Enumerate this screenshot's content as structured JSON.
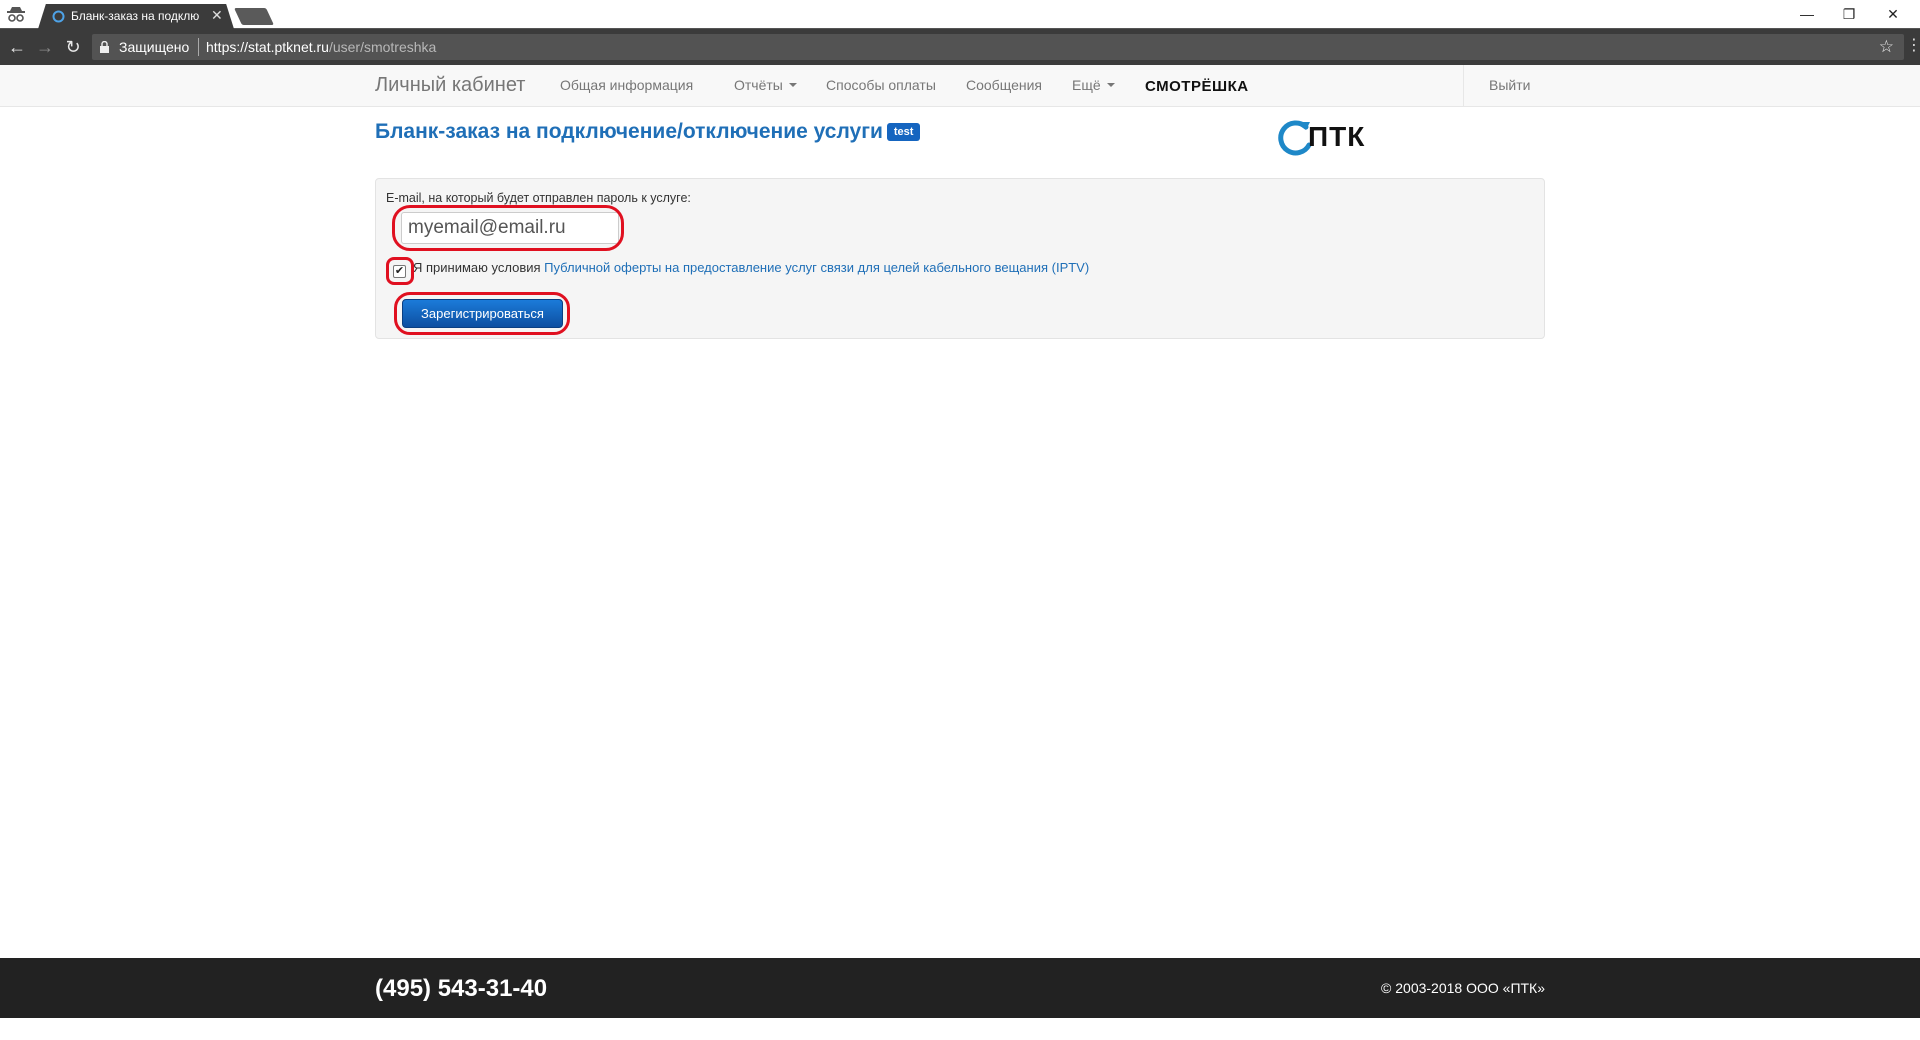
{
  "browser": {
    "tab_title": "Бланк-заказ на подклю",
    "tab_close": "✕",
    "secure_label": "Защищено",
    "url_host": "https://stat.ptknet.ru",
    "url_path": "/user/smotreshka",
    "window_controls": {
      "minimize": "—",
      "restore": "❐",
      "close": "✕"
    },
    "nav": {
      "back": "←",
      "forward": "→",
      "reload": "↻"
    },
    "star": "☆",
    "menu": "⋮"
  },
  "navbar": {
    "brand": "Личный кабинет",
    "items": [
      {
        "label": "Общая информация"
      },
      {
        "label": "Отчёты"
      },
      {
        "label": "Способы оплаты"
      },
      {
        "label": "Сообщения"
      },
      {
        "label": "Ещё"
      }
    ],
    "partner_logo": "СМОТРЁШКА",
    "logout": "Выйти"
  },
  "page": {
    "title": "Бланк-заказ на подключение/отключение услуги",
    "badge": "test",
    "company_logo": "ПТК"
  },
  "form": {
    "email_label": "E-mail, на который будет отправлен пароль к услуге:",
    "email_value": "myemail@email.ru",
    "agree_checked": true,
    "agree_prefix": "Я принимаю условия",
    "agree_link": "Публичной оферты на предоставление услуг связи для целей кабельного вещания (IPTV)",
    "submit_label": "Зарегистрироваться"
  },
  "footer": {
    "phone": "(495) 543-31-40",
    "copyright": "© 2003-2018 ООО «ПТК»"
  },
  "colors": {
    "accent": "#1f6fb7",
    "button": "#0d4fa1",
    "highlight": "#e01020",
    "footer": "#222222"
  }
}
